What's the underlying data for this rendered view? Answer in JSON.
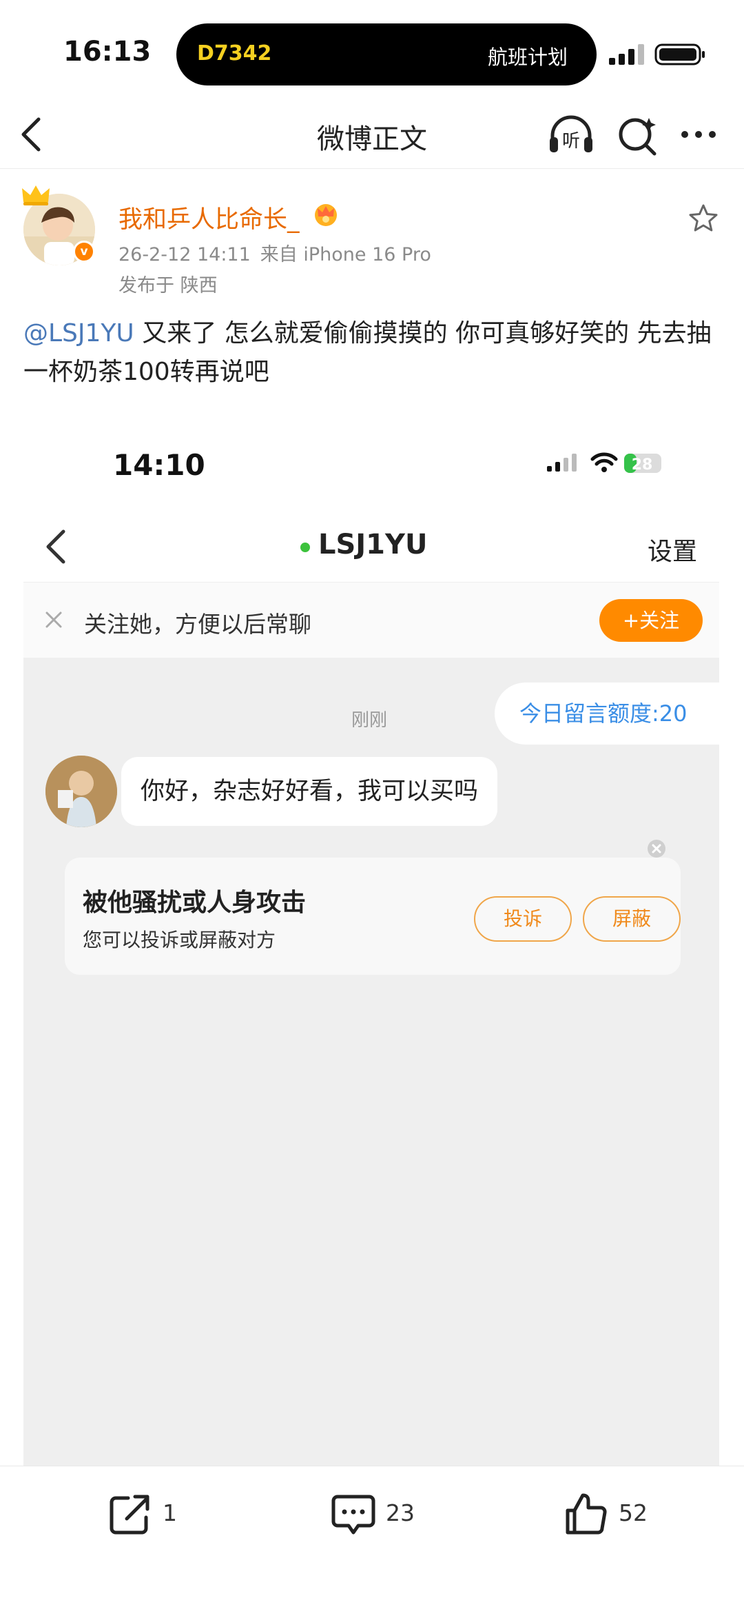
{
  "status_bar": {
    "time": "16:13",
    "island_left": "D7342",
    "island_right": "航班计划"
  },
  "nav": {
    "title": "微博正文"
  },
  "post": {
    "username": "我和乒人比命长_",
    "time": "26-2-12 14:11",
    "source": "来自 iPhone 16 Pro",
    "location": "发布于 陕西",
    "mention": "@LSJ1YU",
    "text": "又来了 怎么就爱偷偷摸摸的 你可真够好笑的 先去抽一杯奶茶100转再说吧"
  },
  "embedded_screenshot": {
    "time": "14:10",
    "battery": "28",
    "chat_title": "LSJ1YU",
    "settings_label": "设置",
    "follow_prompt": "关注她，方便以后常聊",
    "follow_button": "+关注",
    "quota_label": "今日留言额度:20",
    "timestamp": "刚刚",
    "message": "你好，杂志好好看，我可以买吗",
    "report_title": "被他骚扰或人身攻击",
    "report_subtitle": "您可以投诉或屏蔽对方",
    "complain_button": "投诉",
    "block_button": "屏蔽"
  },
  "actions": {
    "share_count": "1",
    "comment_count": "23",
    "like_count": "52"
  },
  "colors": {
    "brand_orange": "#ff8200",
    "username_orange": "#e86a00",
    "mention_blue": "#4a79b8",
    "quota_blue": "#3a8ee6",
    "online_green": "#3cc23c"
  }
}
